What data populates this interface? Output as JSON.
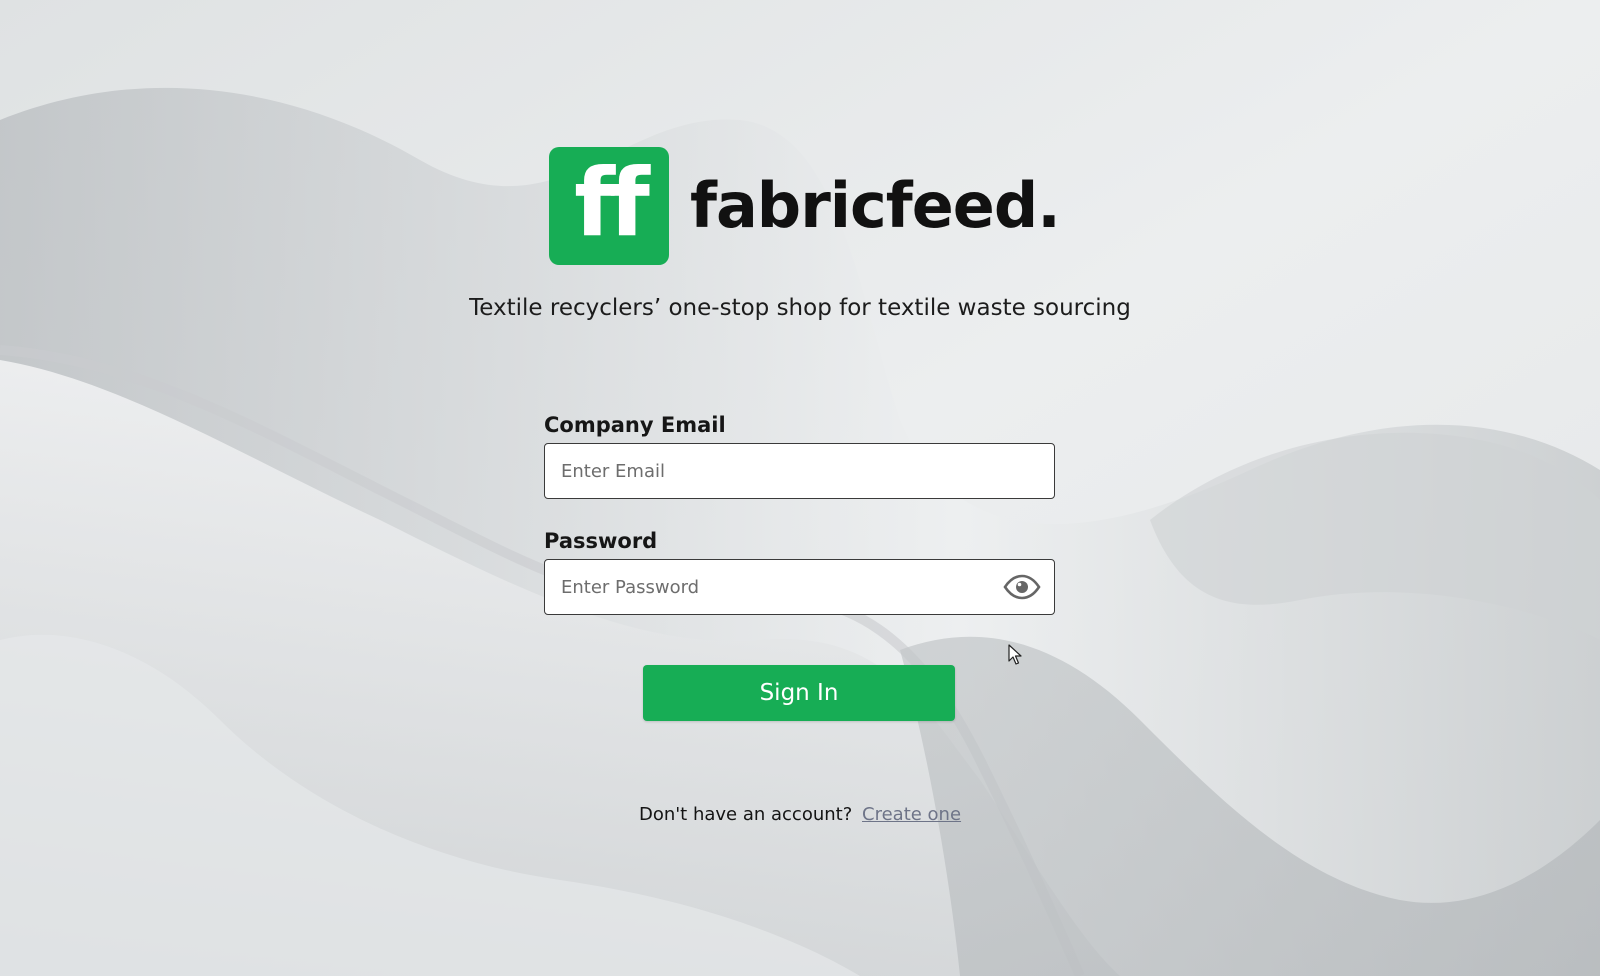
{
  "brand": {
    "logo_letters": "ff",
    "name": "fabricfeed.",
    "tagline": "Textile recyclers’ one-stop shop for textile waste sourcing",
    "accent_color": "#17ad55"
  },
  "form": {
    "email": {
      "label": "Company Email",
      "placeholder": "Enter Email",
      "value": ""
    },
    "password": {
      "label": "Password",
      "placeholder": "Enter Password",
      "value": "",
      "toggle_icon": "eye-icon"
    },
    "submit_label": "Sign In"
  },
  "footer": {
    "prompt": "Don't have an account?",
    "link_label": "Create one"
  }
}
